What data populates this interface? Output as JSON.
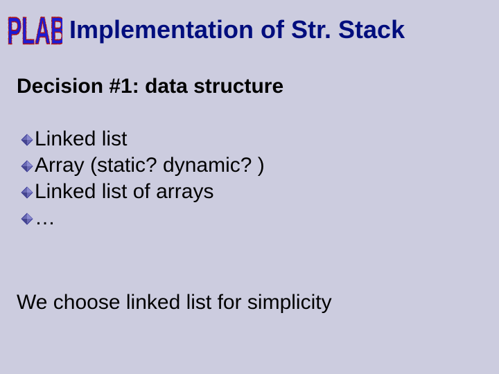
{
  "logo": {
    "text": "PLAB"
  },
  "title": "Implementation of Str. Stack",
  "subtitle": "Decision #1: data structure",
  "bullets": [
    "Linked list",
    "Array (static? dynamic? )",
    "Linked list of arrays",
    "…"
  ],
  "conclusion": "We choose linked list for simplicity",
  "colors": {
    "background": "#ccccdf",
    "title": "#000d7d",
    "bullet_fill": "#6a6ab3",
    "bullet_edge": "#2b2b8f",
    "logo_fill": "#1a1ad4",
    "logo_stroke": "#b01919"
  }
}
